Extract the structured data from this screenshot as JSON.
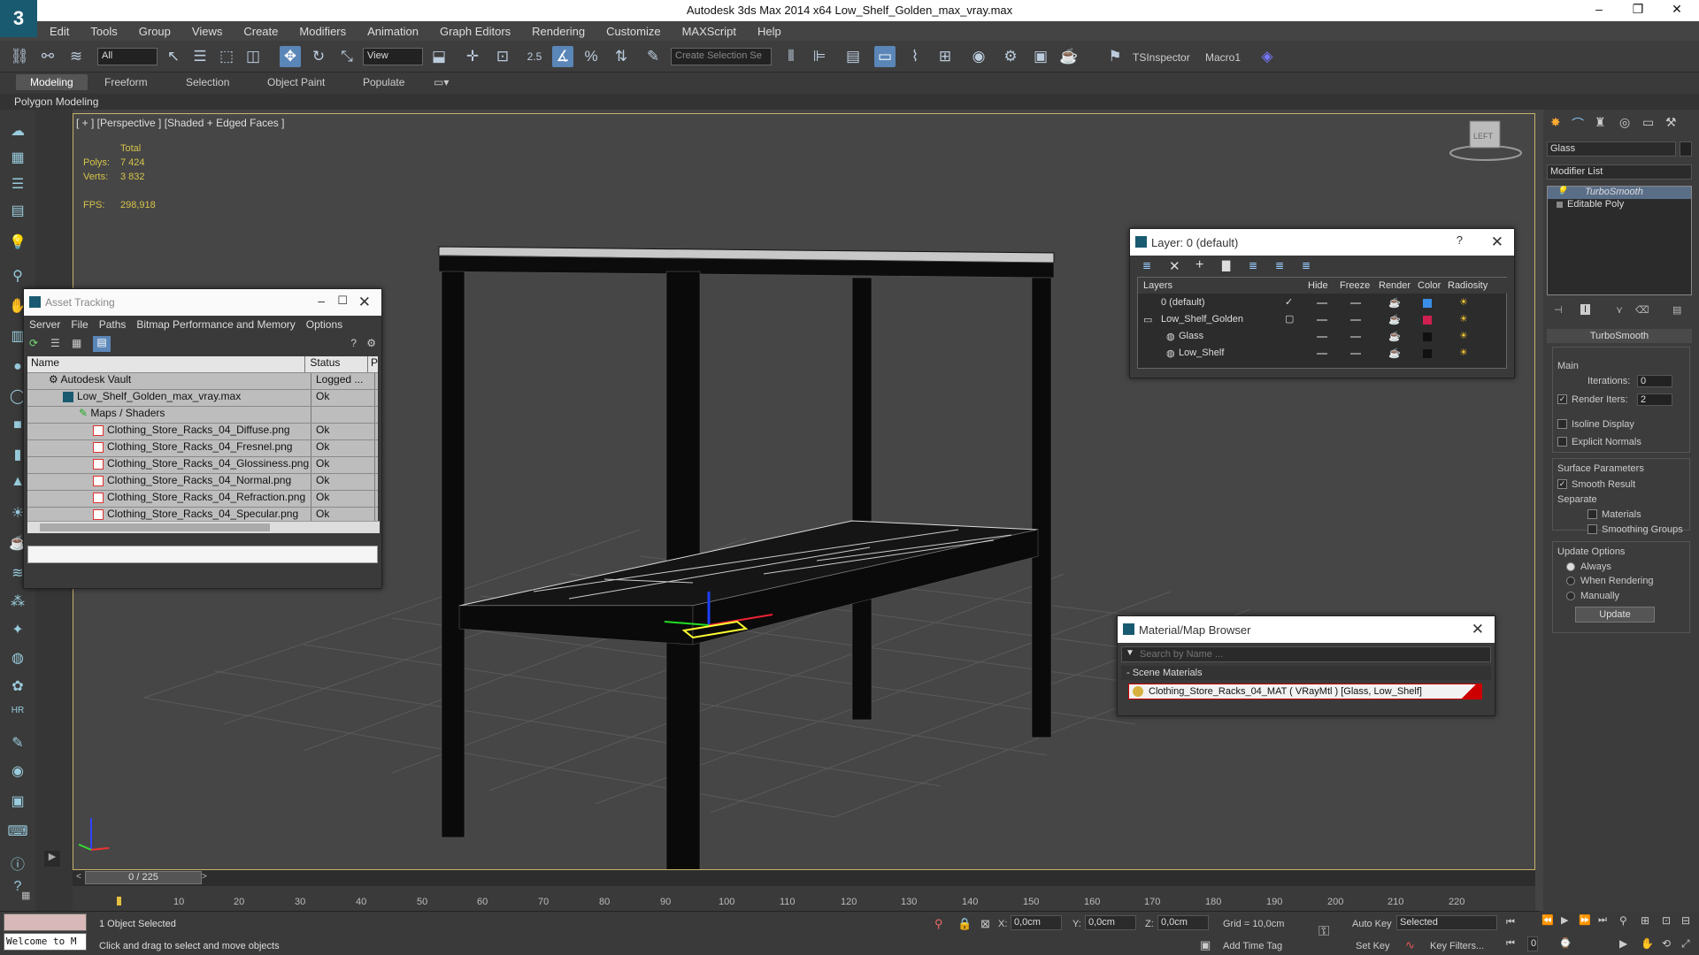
{
  "app": {
    "title": "Autodesk 3ds Max  2014 x64     Low_Shelf_Golden_max_vray.max",
    "logo": "3"
  },
  "window_controls": {
    "minimize": "–",
    "maximize": "❐",
    "close": "✕"
  },
  "menu": [
    "Edit",
    "Tools",
    "Group",
    "Views",
    "Create",
    "Modifiers",
    "Animation",
    "Graph Editors",
    "Rendering",
    "Customize",
    "MAXScript",
    "Help"
  ],
  "toolbar": {
    "filter": "All",
    "ref_coord": "View",
    "snap_value": "2.5",
    "selection_set_placeholder": "Create Selection Se",
    "tsinspector": "TSInspector",
    "macro1": "Macro1"
  },
  "ribbon": {
    "tabs": [
      "Modeling",
      "Freeform",
      "Selection",
      "Object Paint",
      "Populate"
    ],
    "sub": "Polygon Modeling"
  },
  "viewport": {
    "label": "[ + ] [Perspective ] [Shaded + Edged Faces ]",
    "stats": {
      "total_label": "Total",
      "polys_label": "Polys:",
      "polys": "7 424",
      "verts_label": "Verts:",
      "verts": "3 832",
      "fps_label": "FPS:",
      "fps": "298,918"
    },
    "viewcube_label": "LEFT"
  },
  "asset_tracking": {
    "title": "Asset Tracking",
    "menu": [
      "Server",
      "File",
      "Paths",
      "Bitmap Performance and Memory",
      "Options"
    ],
    "columns": [
      "Name",
      "Status",
      "P"
    ],
    "rows": [
      {
        "name": "Autodesk Vault",
        "status": "Logged ..."
      },
      {
        "name": "Low_Shelf_Golden_max_vray.max",
        "status": "Ok"
      },
      {
        "name": "Maps / Shaders",
        "status": ""
      },
      {
        "name": "Clothing_Store_Racks_04_Diffuse.png",
        "status": "Ok"
      },
      {
        "name": "Clothing_Store_Racks_04_Fresnel.png",
        "status": "Ok"
      },
      {
        "name": "Clothing_Store_Racks_04_Glossiness.png",
        "status": "Ok"
      },
      {
        "name": "Clothing_Store_Racks_04_Normal.png",
        "status": "Ok"
      },
      {
        "name": "Clothing_Store_Racks_04_Refraction.png",
        "status": "Ok"
      },
      {
        "name": "Clothing_Store_Racks_04_Specular.png",
        "status": "Ok"
      }
    ]
  },
  "layer_window": {
    "title": "Layer: 0 (default)",
    "help": "?",
    "columns": [
      "Layers",
      "Hide",
      "Freeze",
      "Render",
      "Color",
      "Radiosity"
    ],
    "rows": [
      {
        "name": "0 (default)",
        "color": "#3a8ee8"
      },
      {
        "name": "Low_Shelf_Golden",
        "color": "#d02050"
      },
      {
        "name": "Glass",
        "color": "#222222"
      },
      {
        "name": "Low_Shelf",
        "color": "#222222"
      }
    ]
  },
  "material_browser": {
    "title": "Material/Map Browser",
    "search_placeholder": "Search by Name ...",
    "section": "- Scene Materials",
    "item": "Clothing_Store_Racks_04_MAT  ( VRayMtl )  [Glass, Low_Shelf]"
  },
  "command_panel": {
    "object_name": "Glass",
    "modifier_list": "Modifier List",
    "stack": [
      "TurboSmooth",
      "Editable Poly"
    ],
    "rollout_title": "TurboSmooth",
    "main_label": "Main",
    "iterations_label": "Iterations:",
    "iterations": "0",
    "render_iters_label": "Render Iters:",
    "render_iters": "2",
    "isoline_label": "Isoline Display",
    "explicit_normals_label": "Explicit Normals",
    "surface_label": "Surface Parameters",
    "smooth_result_label": "Smooth Result",
    "separate_label": "Separate",
    "materials_label": "Materials",
    "smoothing_groups_label": "Smoothing Groups",
    "update_options_label": "Update Options",
    "always_label": "Always",
    "when_rendering_label": "When Rendering",
    "manually_label": "Manually",
    "update_button": "Update"
  },
  "timeline": {
    "frame": "0 / 225",
    "ticks": [
      "10",
      "20",
      "30",
      "40",
      "50",
      "60",
      "70",
      "80",
      "90",
      "100",
      "110",
      "120",
      "130",
      "140",
      "150",
      "160",
      "170",
      "180",
      "190",
      "200",
      "210",
      "220"
    ]
  },
  "status": {
    "maxscript": "Welcome to M",
    "selected": "1 Object Selected",
    "prompt": "Click and drag to select and move objects",
    "x_label": "X:",
    "x": "0,0cm",
    "y_label": "Y:",
    "y": "0,0cm",
    "z_label": "Z:",
    "z": "0,0cm",
    "grid": "Grid = 10,0cm",
    "add_time_tag": "Add Time Tag",
    "auto_key": "Auto Key",
    "set_key": "Set Key",
    "selected_set": "Selected",
    "key_filters": "Key Filters...",
    "current_frame": "0"
  }
}
